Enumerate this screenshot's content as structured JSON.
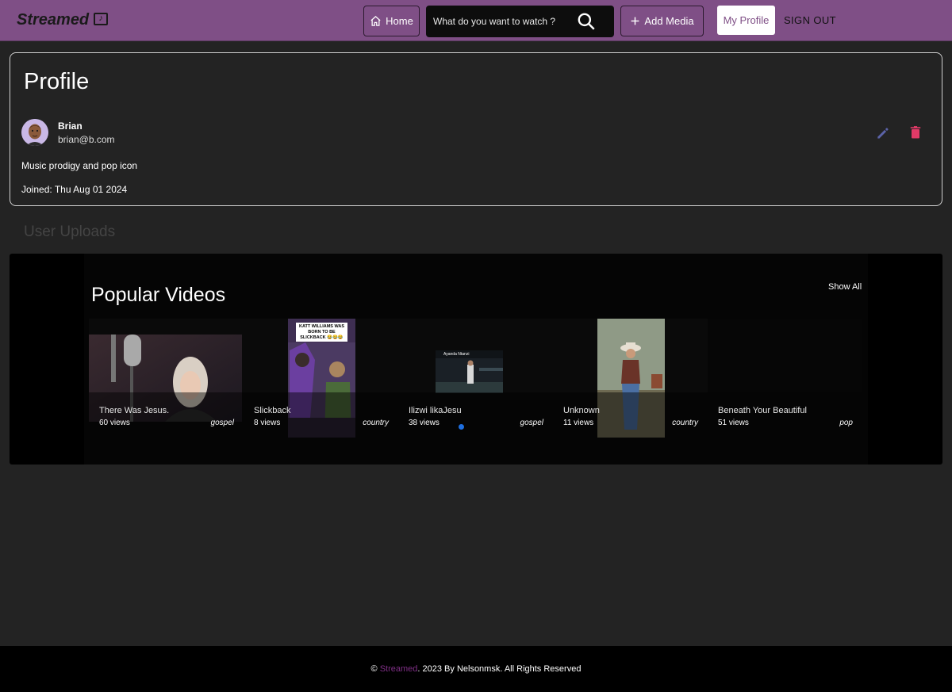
{
  "nav": {
    "brand": "Streamed",
    "home_label": "Home",
    "search_placeholder": "What do you want to watch ?",
    "add_media_label": "Add Media",
    "my_profile_label": "My Profile",
    "sign_out_label": "SIGN OUT",
    "accent": "#7f4f86"
  },
  "profile": {
    "title": "Profile",
    "name": "Brian",
    "email": "brian@b.com",
    "bio": "Music prodigy and pop icon",
    "joined": "Joined: Thu Aug 01 2024",
    "edit_color": "#5b63a8",
    "delete_color": "#e03a67"
  },
  "uploads": {
    "title": "User Uploads",
    "section_title": "Popular Videos",
    "show_all": "Show All",
    "videos": [
      {
        "title": "There Was Jesus.",
        "views": "60 views",
        "genre": "gospel"
      },
      {
        "title": "Slickback",
        "views": "8 views",
        "genre": "country",
        "thumb_caption": "KATT WILLIAMS WAS BORN TO BE SLICKBACK 😂😂😂"
      },
      {
        "title": "Ilizwi likaJesu",
        "views": "38 views",
        "genre": "gospel",
        "thumb_caption": "Ayanda Ntanzi"
      },
      {
        "title": "Unknown",
        "views": "11 views",
        "genre": "country"
      },
      {
        "title": "Beneath Your Beautiful",
        "views": "51 views",
        "genre": "pop"
      }
    ]
  },
  "footer": {
    "copyright": "©",
    "brand": "Streamed",
    "text": ". 2023  By Nelsonmsk. All Rights Reserved"
  }
}
